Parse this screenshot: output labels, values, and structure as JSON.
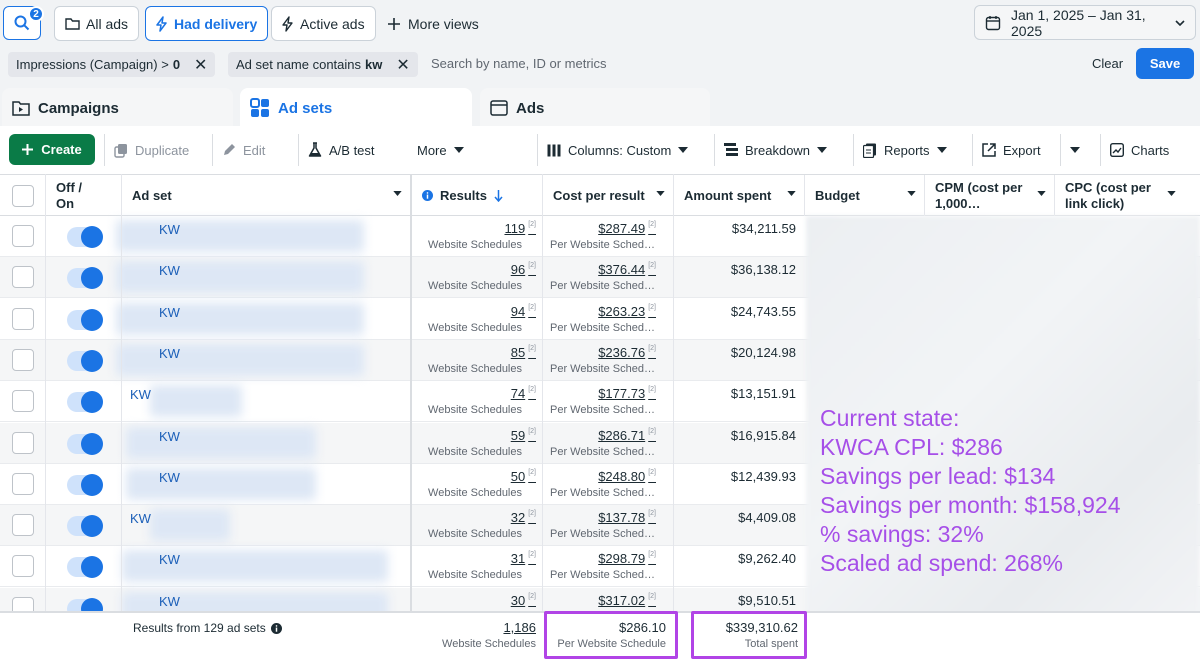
{
  "topbar": {
    "search_badge": "2",
    "all_ads": "All ads",
    "had_delivery": "Had delivery",
    "active_ads": "Active ads",
    "more_views": "More views",
    "date_range": "Jan 1, 2025 – Jan 31, 2025"
  },
  "filters": {
    "chip1_label": "Impressions (Campaign) >",
    "chip1_value": "0",
    "chip2_label": "Ad set name contains",
    "chip2_value": "kw",
    "search_placeholder": "Search by name, ID or metrics",
    "clear": "Clear",
    "save": "Save"
  },
  "tabs": [
    {
      "label": "Campaigns"
    },
    {
      "label": "Ad sets"
    },
    {
      "label": "Ads"
    }
  ],
  "toolbar": {
    "create": "Create",
    "duplicate": "Duplicate",
    "edit": "Edit",
    "ab_test": "A/B test",
    "more": "More",
    "columns": "Columns: Custom",
    "breakdown": "Breakdown",
    "reports": "Reports",
    "export": "Export",
    "charts": "Charts"
  },
  "columns": {
    "off_on": "Off / On",
    "ad_set": "Ad set",
    "results": "Results",
    "cost_per_result": "Cost per result",
    "amount_spent": "Amount spent",
    "budget": "Budget",
    "cpm": "CPM (cost per 1,000…",
    "cpc": "CPC (cost per link click)"
  },
  "rows": [
    {
      "name": "KW",
      "results": "119",
      "results_sub": "Website Schedules",
      "cpr": "$287.49",
      "cpr_sub": "Per Website Sched…",
      "amount": "$34,211.59"
    },
    {
      "name": "KW",
      "results": "96",
      "results_sub": "Website Schedules",
      "cpr": "$376.44",
      "cpr_sub": "Per Website Sched…",
      "amount": "$36,138.12"
    },
    {
      "name": "KW",
      "results": "94",
      "results_sub": "Website Schedules",
      "cpr": "$263.23",
      "cpr_sub": "Per Website Sched…",
      "amount": "$24,743.55"
    },
    {
      "name": "KW",
      "results": "85",
      "results_sub": "Website Schedules",
      "cpr": "$236.76",
      "cpr_sub": "Per Website Sched…",
      "amount": "$20,124.98"
    },
    {
      "name": "KW",
      "results": "74",
      "results_sub": "Website Schedules",
      "cpr": "$177.73",
      "cpr_sub": "Per Website Sched…",
      "amount": "$13,151.91"
    },
    {
      "name": "KW",
      "results": "59",
      "results_sub": "Website Schedules",
      "cpr": "$286.71",
      "cpr_sub": "Per Website Sched…",
      "amount": "$16,915.84"
    },
    {
      "name": "KW",
      "results": "50",
      "results_sub": "Website Schedules",
      "cpr": "$248.80",
      "cpr_sub": "Per Website Sched…",
      "amount": "$12,439.93"
    },
    {
      "name": "KW",
      "results": "32",
      "results_sub": "Website Schedules",
      "cpr": "$137.78",
      "cpr_sub": "Per Website Sched…",
      "amount": "$4,409.08"
    },
    {
      "name": "KW",
      "results": "31",
      "results_sub": "Website Schedules",
      "cpr": "$298.79",
      "cpr_sub": "Per Website Sched…",
      "amount": "$9,262.40"
    },
    {
      "name": "KW",
      "results": "30",
      "results_sub": "",
      "cpr": "$317.02",
      "cpr_sub": "",
      "amount": "$9,510.51"
    }
  ],
  "footer": {
    "summary": "Results from 129 ad sets",
    "results_total": "1,186",
    "results_sub": "Website Schedules",
    "cpr_total": "$286.10",
    "cpr_sub": "Per Website Schedule",
    "amount_total": "$339,310.62",
    "amount_sub": "Total spent"
  },
  "annotation": {
    "line1": "Current state:",
    "line2": "KWCA CPL: $286",
    "line3": "Savings per lead: $134",
    "line4": "Savings per month: $158,924",
    "line5": "% savings: 32%",
    "line6": "Scaled ad spend: 268%"
  },
  "colors": {
    "accent": "#1b74e4",
    "create_green": "#0a7b47",
    "annotation_purple": "#a64fe8"
  }
}
